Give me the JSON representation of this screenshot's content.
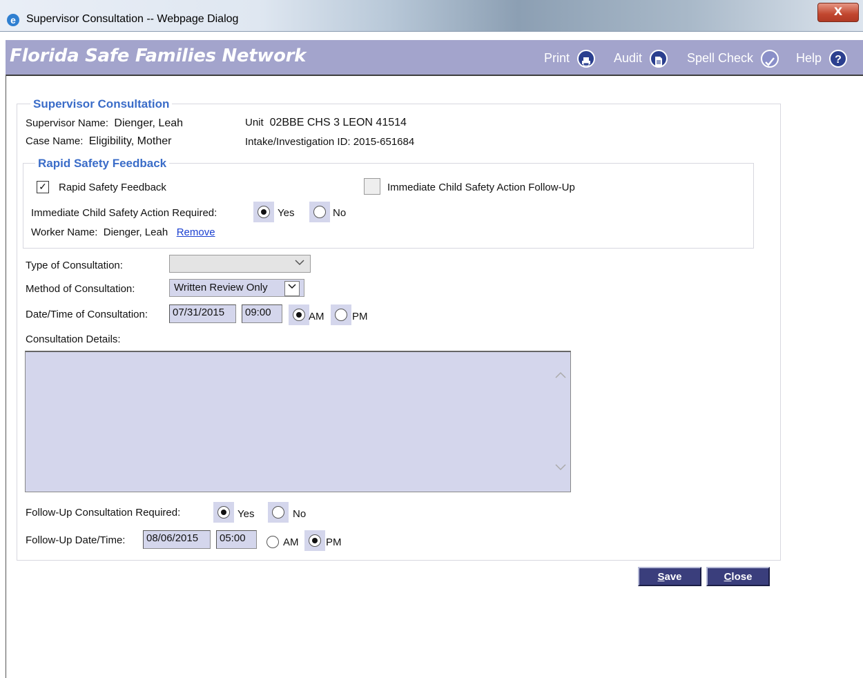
{
  "window": {
    "title": "Supervisor Consultation -- Webpage Dialog",
    "close_glyph": "X"
  },
  "banner": {
    "brand": "Florida Safe Families Network",
    "tools": [
      {
        "label": "Print",
        "icon": "print-icon"
      },
      {
        "label": "Audit",
        "icon": "document-icon"
      },
      {
        "label": "Spell Check",
        "icon": "spell-check-icon"
      },
      {
        "label": "Help",
        "icon": "help-icon",
        "glyph": "?"
      }
    ]
  },
  "consultation": {
    "legend": "Supervisor Consultation",
    "supervisor_label": "Supervisor Name:",
    "supervisor_value": "Dienger, Leah",
    "unit_label": "Unit",
    "unit_value": "02BBE CHS 3 LEON 41514",
    "case_label": "Case Name:",
    "case_value": "Eligibility, Mother",
    "intake_label": "Intake/Investigation ID:",
    "intake_value": "2015-651684"
  },
  "rapid": {
    "legend": "Rapid Safety Feedback",
    "checkbox_label": "Rapid Safety Feedback",
    "checkbox_checked": true,
    "followup_label": "Immediate Child Safety Action Follow-Up",
    "followup_checked": false,
    "required_label": "Immediate Child Safety Action Required:",
    "yes": "Yes",
    "no": "No",
    "selected": "Yes",
    "worker_label": "Worker Name:",
    "worker_value": "Dienger, Leah",
    "remove_link": "Remove"
  },
  "form": {
    "type_label": "Type of Consultation:",
    "type_value": "",
    "method_label": "Method of Consultation:",
    "method_value": "Written Review Only",
    "datetime_label": "Date/Time of Consultation:",
    "date_value": "07/31/2015",
    "time_value": "09:00",
    "am": "AM",
    "pm": "PM",
    "ampm_selected": "AM",
    "details_label": "Consultation Details:",
    "details_value": "",
    "followup_label": "Follow-Up Consultation Required:",
    "followup_yes": "Yes",
    "followup_no": "No",
    "followup_selected": "Yes",
    "followup_dt_label": "Follow-Up Date/Time:",
    "followup_date": "08/06/2015",
    "followup_time": "05:00",
    "followup_ampm_selected": "PM"
  },
  "buttons": {
    "save_first": "S",
    "save_rest": "ave",
    "close_first": "C",
    "close_rest": "lose"
  },
  "colors": {
    "banner": "#a3a4cc",
    "field": "#d4d6ec",
    "legend": "#3a6cc8",
    "button": "#3a3e7c"
  }
}
